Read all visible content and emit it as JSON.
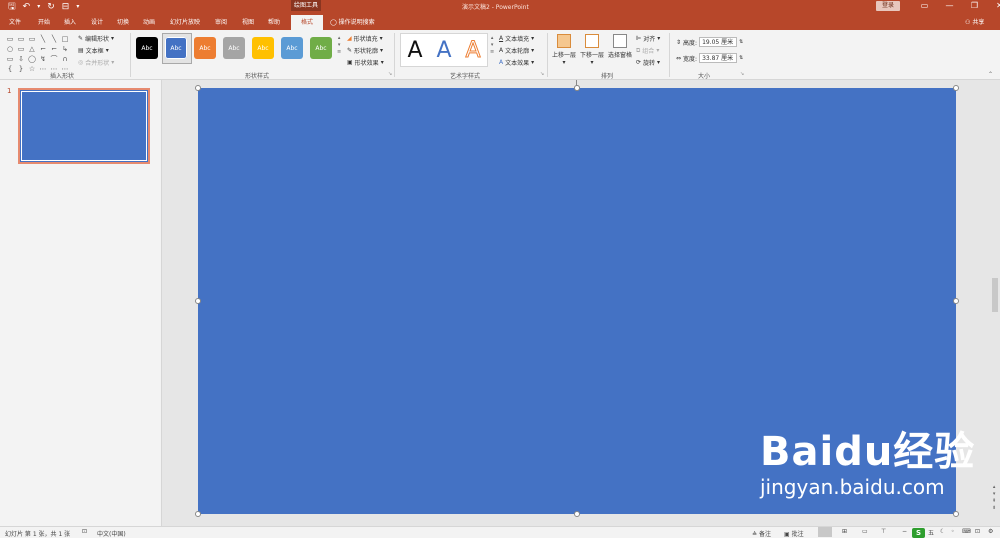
{
  "qat": {
    "save": "🖫",
    "undo": "↶",
    "undo_more": "▾",
    "redo": "↻",
    "start_icon": "⊟",
    "customize": "▾"
  },
  "title_bar": {
    "drawing_tools": "绘图工具",
    "doc_title": "演示文稿2 - PowerPoint",
    "login": "登录"
  },
  "window": {
    "ribbon_display": "▭",
    "minimize": "—",
    "restore": "❐",
    "close": "✕"
  },
  "tabs": [
    "文件",
    "开始",
    "插入",
    "设计",
    "切换",
    "动画",
    "幻灯片放映",
    "审阅",
    "视图",
    "帮助"
  ],
  "active_tab": "格式",
  "tell_me": "操作说明搜索",
  "share": "共享",
  "ribbon": {
    "insert_shapes": {
      "label": "插入形状",
      "shape_glyphs": [
        "▭",
        "▭",
        "▭",
        "╲",
        "╲",
        "□",
        "○",
        "▭",
        "△",
        "⌐",
        "⌐",
        "↳",
        "▭",
        "⇩",
        "◯",
        "↯",
        "⌒",
        "∩",
        "{",
        "}",
        "☆",
        "⋯",
        "⋯",
        "⋯"
      ],
      "edit_shape": "编辑形状",
      "text_box": "文本框",
      "merge_shapes": "合并形状"
    },
    "shape_styles": {
      "label": "形状样式",
      "swatch_text": "Abc",
      "fill": "形状填充",
      "outline": "形状轮廓",
      "effects": "形状效果"
    },
    "wordart_styles": {
      "label": "艺术字样式",
      "letters": [
        "A",
        "A",
        "A"
      ],
      "text_fill": "文本填充",
      "text_outline": "文本轮廓",
      "text_effects": "文本效果"
    },
    "arrange": {
      "label": "排列",
      "bring_forward": "上移一层",
      "send_backward": "下移一层",
      "selection_pane": "选择窗格",
      "align": "对齐",
      "group": "组合",
      "rotate": "旋转"
    },
    "size": {
      "label": "大小",
      "height_label": "高度:",
      "height_value": "19.05 厘米",
      "width_label": "宽度:",
      "width_value": "33.87 厘米"
    }
  },
  "thumbnails": [
    {
      "number": "1"
    }
  ],
  "status": {
    "slide_info": "幻灯片 第 1 张，共 1 张",
    "language": "中文(中国)",
    "notes": "备注",
    "comments": "批注"
  },
  "watermark": {
    "brand": "Baidu经验",
    "url": "jingyan.baidu.com"
  },
  "ime": {
    "logo": "S",
    "mode": "五"
  },
  "colors": {
    "title_bar": "#b7472a",
    "slide_fill": "#4472c4",
    "swatches": [
      "#000000",
      "#4472c4",
      "#ed7d31",
      "#a5a5a5",
      "#ffc000",
      "#5b9bd5",
      "#70ad47"
    ],
    "wordart": [
      "#111111",
      "#4472c4",
      "#ed7d31"
    ]
  }
}
